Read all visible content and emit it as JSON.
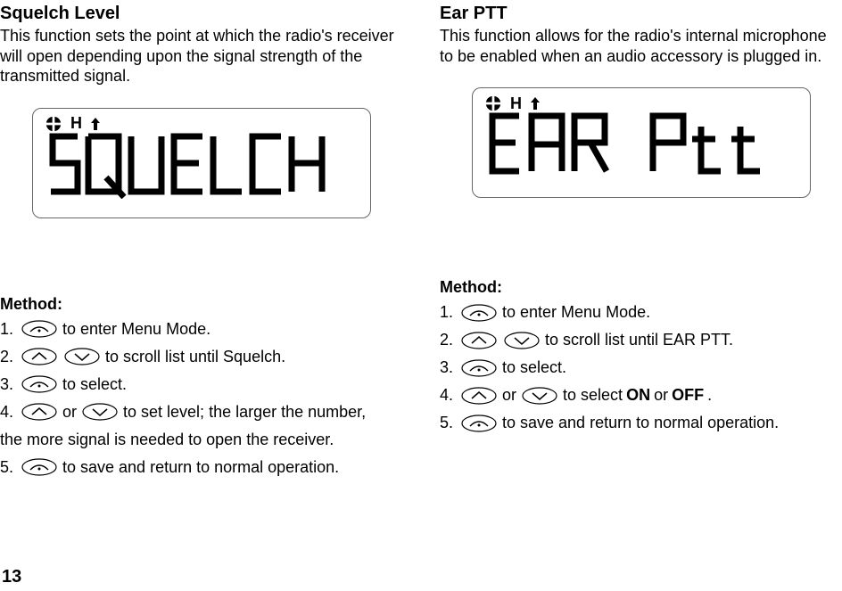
{
  "left": {
    "title": "Squelch Level",
    "desc": "This function sets the point at which the radio's receiver will open depending upon the signal strength of the transmitted signal.",
    "lcd_indicator": "H",
    "method_label": "Method:",
    "steps": {
      "s1_num": "1.",
      "s1_text": " to enter Menu Mode.",
      "s2_num": "2.",
      "s2_text": "    to scroll list until Squelch.",
      "s3_num": "3.",
      "s3_text": " to select.",
      "s4_num": "4.",
      "s4_or": " or ",
      "s4_text": " to set level; the larger the number,",
      "s4_cont": "the more signal is needed to open the receiver.",
      "s5_num": "5.",
      "s5_text": " to save and return to normal operation."
    }
  },
  "right": {
    "title": "Ear PTT",
    "desc": "This function allows for the radio's internal microphone to be enabled when an audio accessory is plugged in.",
    "lcd_indicator": "H",
    "method_label": "Method:",
    "steps": {
      "s1_num": "1.",
      "s1_text": "   to enter Menu Mode.",
      "s2_num": "2.",
      "s2_text": "    to scroll list until EAR PTT.",
      "s3_num": "3.",
      "s3_text": "  to select.",
      "s4_num": "4.",
      "s4_mid": "or",
      "s4_text_a": "to select ",
      "s4_on": "ON",
      "s4_or2": " or ",
      "s4_off": "OFF",
      "s4_dot": ".",
      "s5_num": "5.",
      "s5_text": "  to save and return to normal operation."
    }
  },
  "page_number": "13"
}
